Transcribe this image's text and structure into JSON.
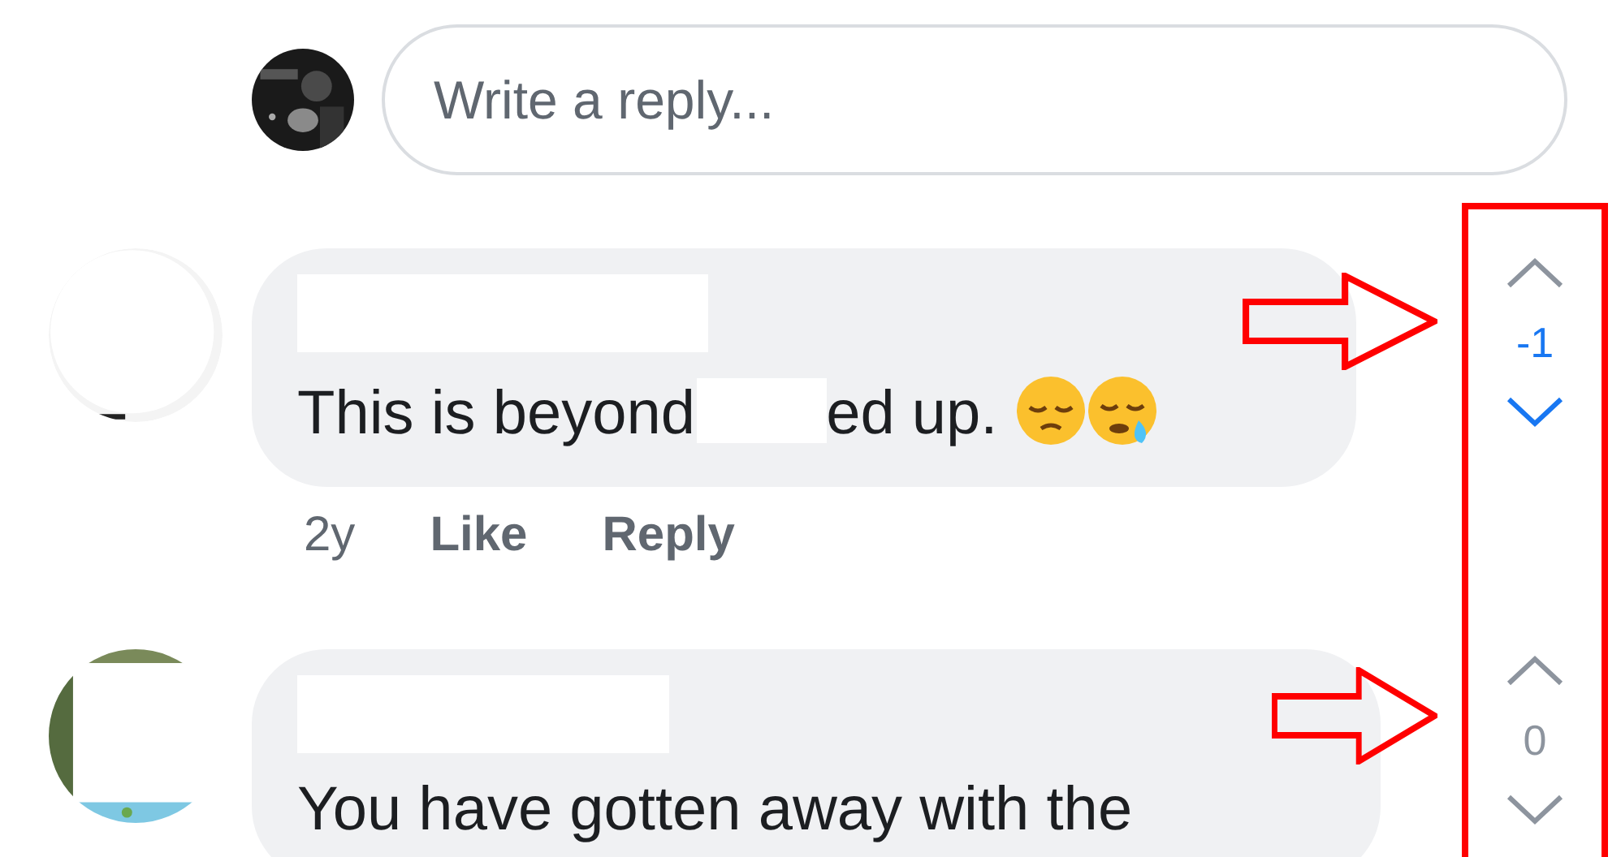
{
  "reply_box": {
    "placeholder": "Write a reply..."
  },
  "comments": [
    {
      "author": {
        "kind": "redaction"
      },
      "avatar": {
        "kind": "picture"
      },
      "parts": [
        {
          "kind": "text",
          "text": "This is beyond"
        },
        {
          "kind": "redaction"
        },
        {
          "kind": "text",
          "text": "ed up."
        },
        {
          "kind": "pensive"
        },
        {
          "kind": "sleepy"
        }
      ],
      "time": "2y",
      "actions": [
        "Like",
        "Reply"
      ],
      "vote": {
        "score": "-1",
        "upvoted": false,
        "downvoted": true
      }
    },
    {
      "author": {
        "kind": "redaction"
      },
      "avatar": {
        "kind": "picture"
      },
      "parts": [
        {
          "kind": "text",
          "text": "You have gotten away with the"
        }
      ],
      "vote": {
        "score": "0",
        "upvoted": false,
        "downvoted": false
      }
    }
  ]
}
